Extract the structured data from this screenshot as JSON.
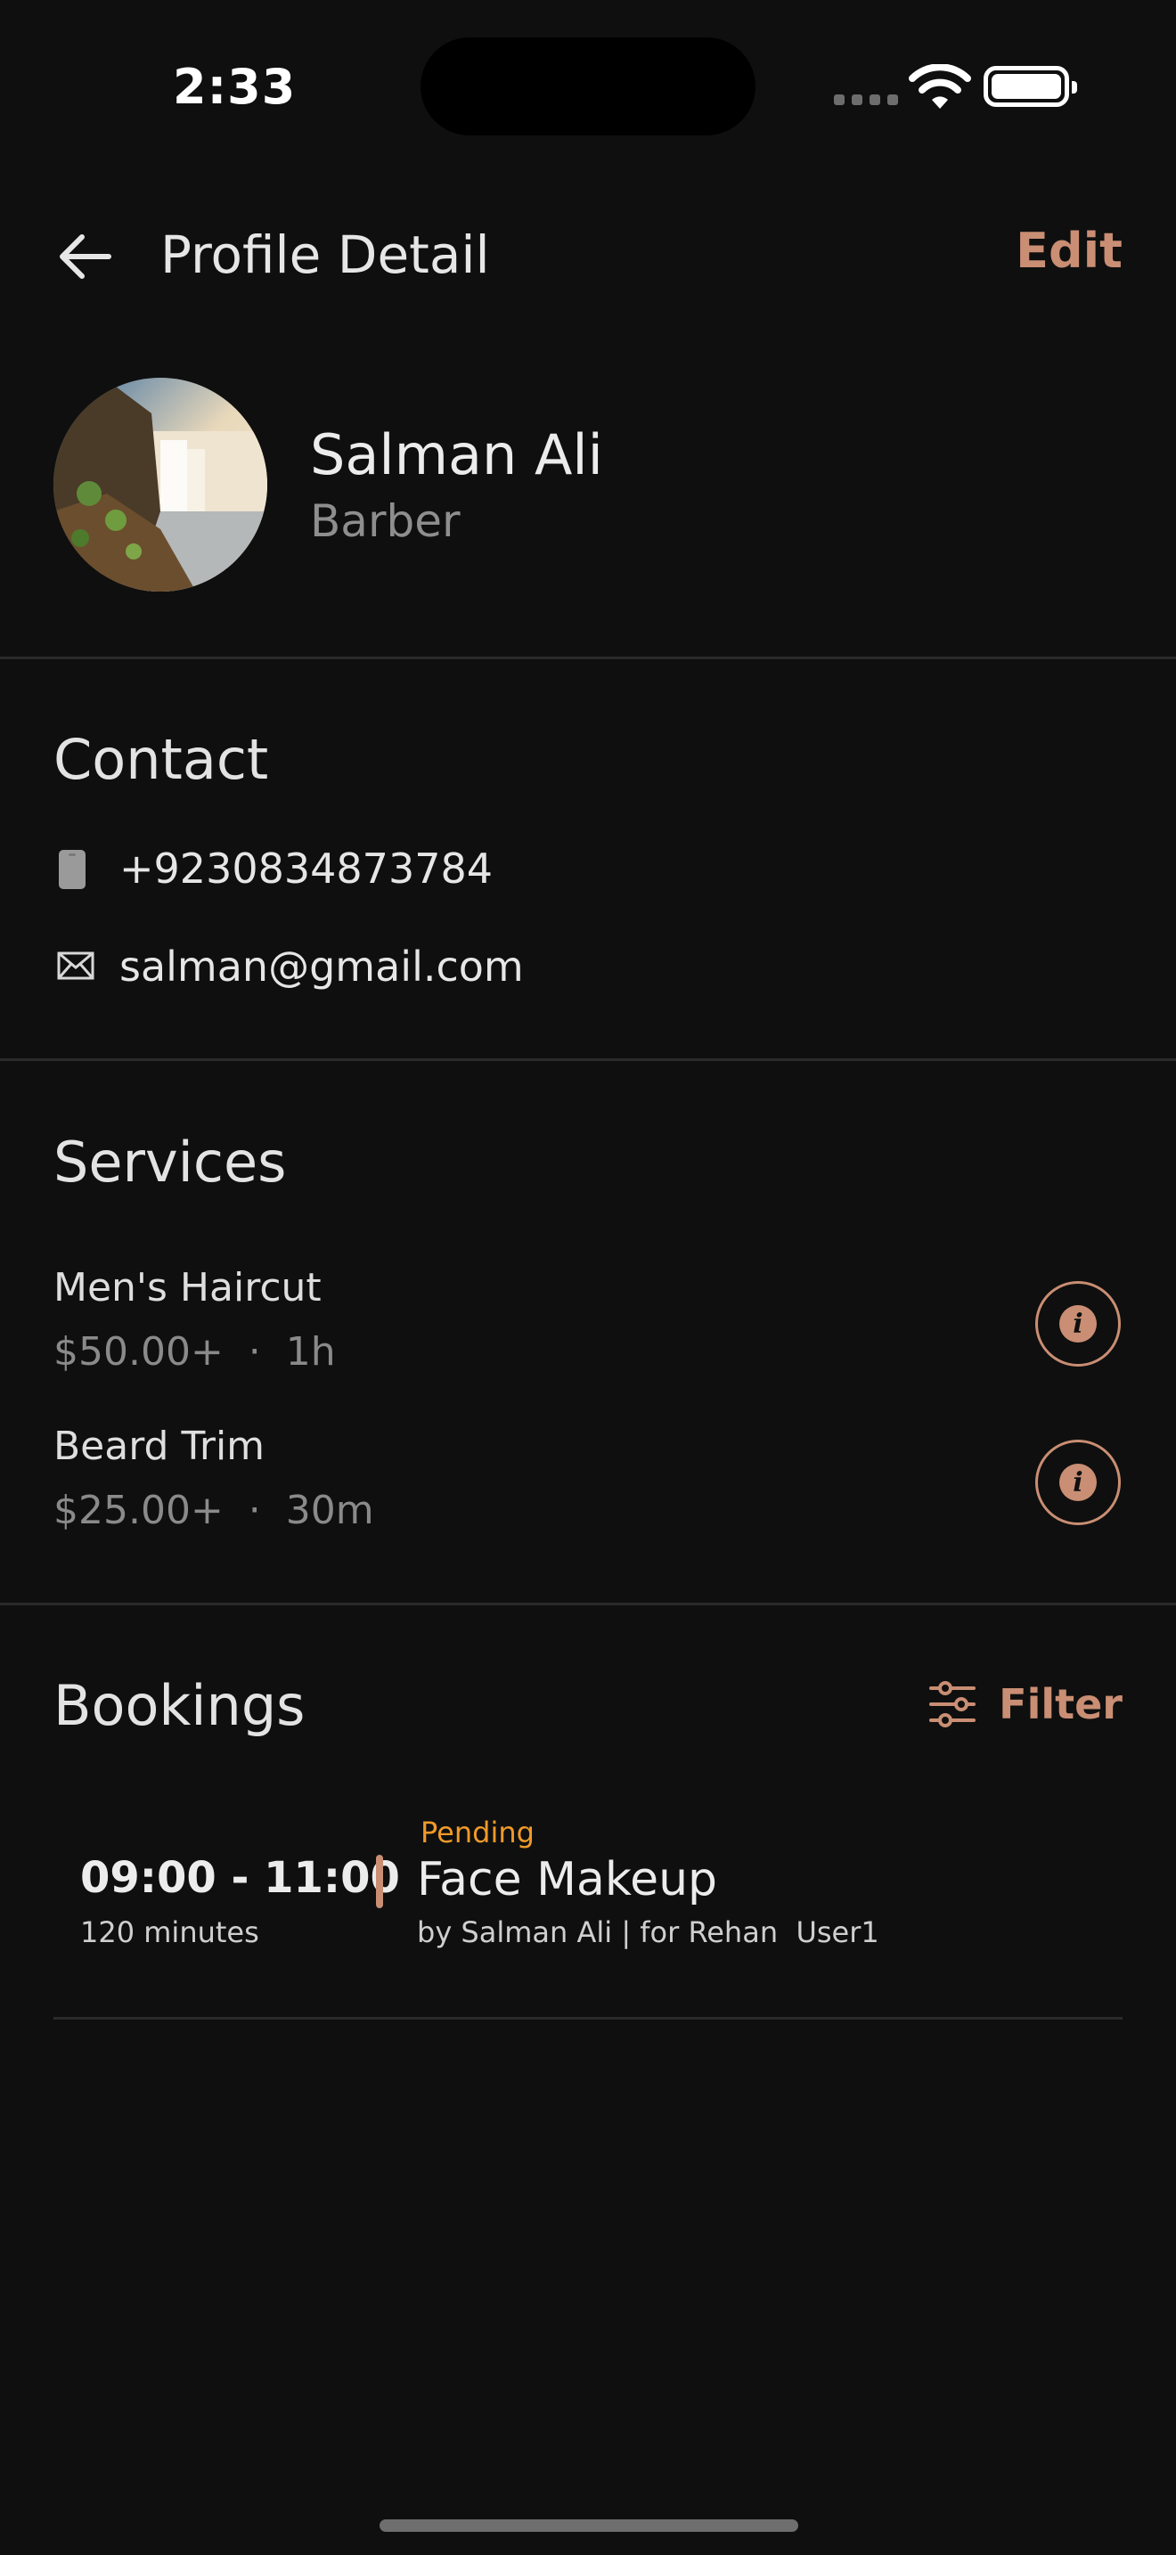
{
  "status_bar": {
    "time": "2:33"
  },
  "header": {
    "title": "Profile Detail",
    "edit_label": "Edit",
    "back_icon": "arrow-left-icon"
  },
  "profile": {
    "name": "Salman Ali",
    "role": "Barber"
  },
  "contact": {
    "title": "Contact",
    "phone": "+9230834873784",
    "email": "salman@gmail.com"
  },
  "services": {
    "title": "Services",
    "items": [
      {
        "name": "Men's Haircut",
        "meta": "$50.00+  ·  1h"
      },
      {
        "name": "Beard Trim",
        "meta": "$25.00+  ·  30m"
      }
    ]
  },
  "bookings": {
    "title": "Bookings",
    "filter_label": "Filter",
    "items": [
      {
        "status": "Pending",
        "time": "09:00 - 11:00",
        "duration": "120 minutes",
        "title": "Face Makeup",
        "subtitle": "by Salman Ali | for Rehan  User1"
      }
    ]
  },
  "colors": {
    "accent": "#c98e73",
    "pending": "#f09a2a",
    "background": "#0f0f0f"
  }
}
